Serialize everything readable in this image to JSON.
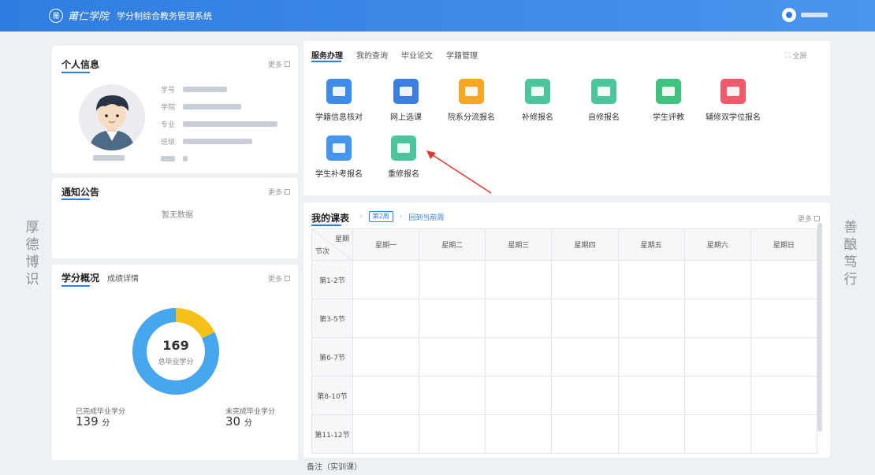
{
  "header": {
    "seal_char": "莆",
    "school_name": "莆仁学院",
    "system_title": "学分制综合教务管理系统"
  },
  "motto": {
    "left": [
      "厚",
      "德",
      "博",
      "识"
    ],
    "right": [
      "善",
      "酿",
      "笃",
      "行"
    ]
  },
  "personal": {
    "title": "个人信息",
    "more": "更多",
    "fields": [
      {
        "label": "学号"
      },
      {
        "label": "学院"
      },
      {
        "label": "专业"
      },
      {
        "label": "班级"
      },
      {
        "label": ""
      }
    ]
  },
  "notice": {
    "title": "通知公告",
    "more": "更多",
    "empty_text": "暂无数据"
  },
  "credits": {
    "tabs": [
      "学分概况",
      "成绩详情"
    ],
    "more": "更多",
    "total": "169",
    "total_label": "总毕业学分",
    "completed_label": "已完成毕业学分",
    "completed_value": "139",
    "remaining_label": "未完成毕业学分",
    "remaining_value": "30",
    "unit": "分",
    "completed_fraction": 0.822,
    "colors": {
      "completed": "#46a6ee",
      "remaining": "#f5c118"
    }
  },
  "services": {
    "tabs": [
      "服务办理",
      "我的查询",
      "毕业论文",
      "学籍管理"
    ],
    "fullscreen": "全屏",
    "items": [
      {
        "label": "学籍信息核对",
        "color": "#3d8ce8",
        "icon": "id-card-icon"
      },
      {
        "label": "网上选课",
        "color": "#3b7ee0",
        "icon": "monitor-icon"
      },
      {
        "label": "院系分流报名",
        "color": "#f5a623",
        "icon": "house-icon"
      },
      {
        "label": "补修报名",
        "color": "#4cc59a",
        "icon": "book-icon"
      },
      {
        "label": "自修报名",
        "color": "#4cc59a",
        "icon": "book-icon"
      },
      {
        "label": "学生评教",
        "color": "#3fc17f",
        "icon": "chat-icon"
      },
      {
        "label": "辅修双学位报名",
        "color": "#ef5a6a",
        "icon": "doc-icon"
      },
      {
        "label": "学生补考报名",
        "color": "#4595ea",
        "icon": "form-icon"
      },
      {
        "label": "重修报名",
        "color": "#4cc59a",
        "icon": "book-icon"
      }
    ]
  },
  "timetable": {
    "title": "我的课表",
    "week": "第2周",
    "back_to_current": "回到当前周",
    "more": "更多",
    "corner_top": "星期",
    "corner_bottom": "节次",
    "days": [
      "星期一",
      "星期二",
      "星期三",
      "星期四",
      "星期五",
      "星期六",
      "星期日"
    ],
    "periods": [
      "第1-2节",
      "第3-5节",
      "第6-7节",
      "第8-10节",
      "第11-12节"
    ],
    "remark": "备注（实训课）"
  }
}
